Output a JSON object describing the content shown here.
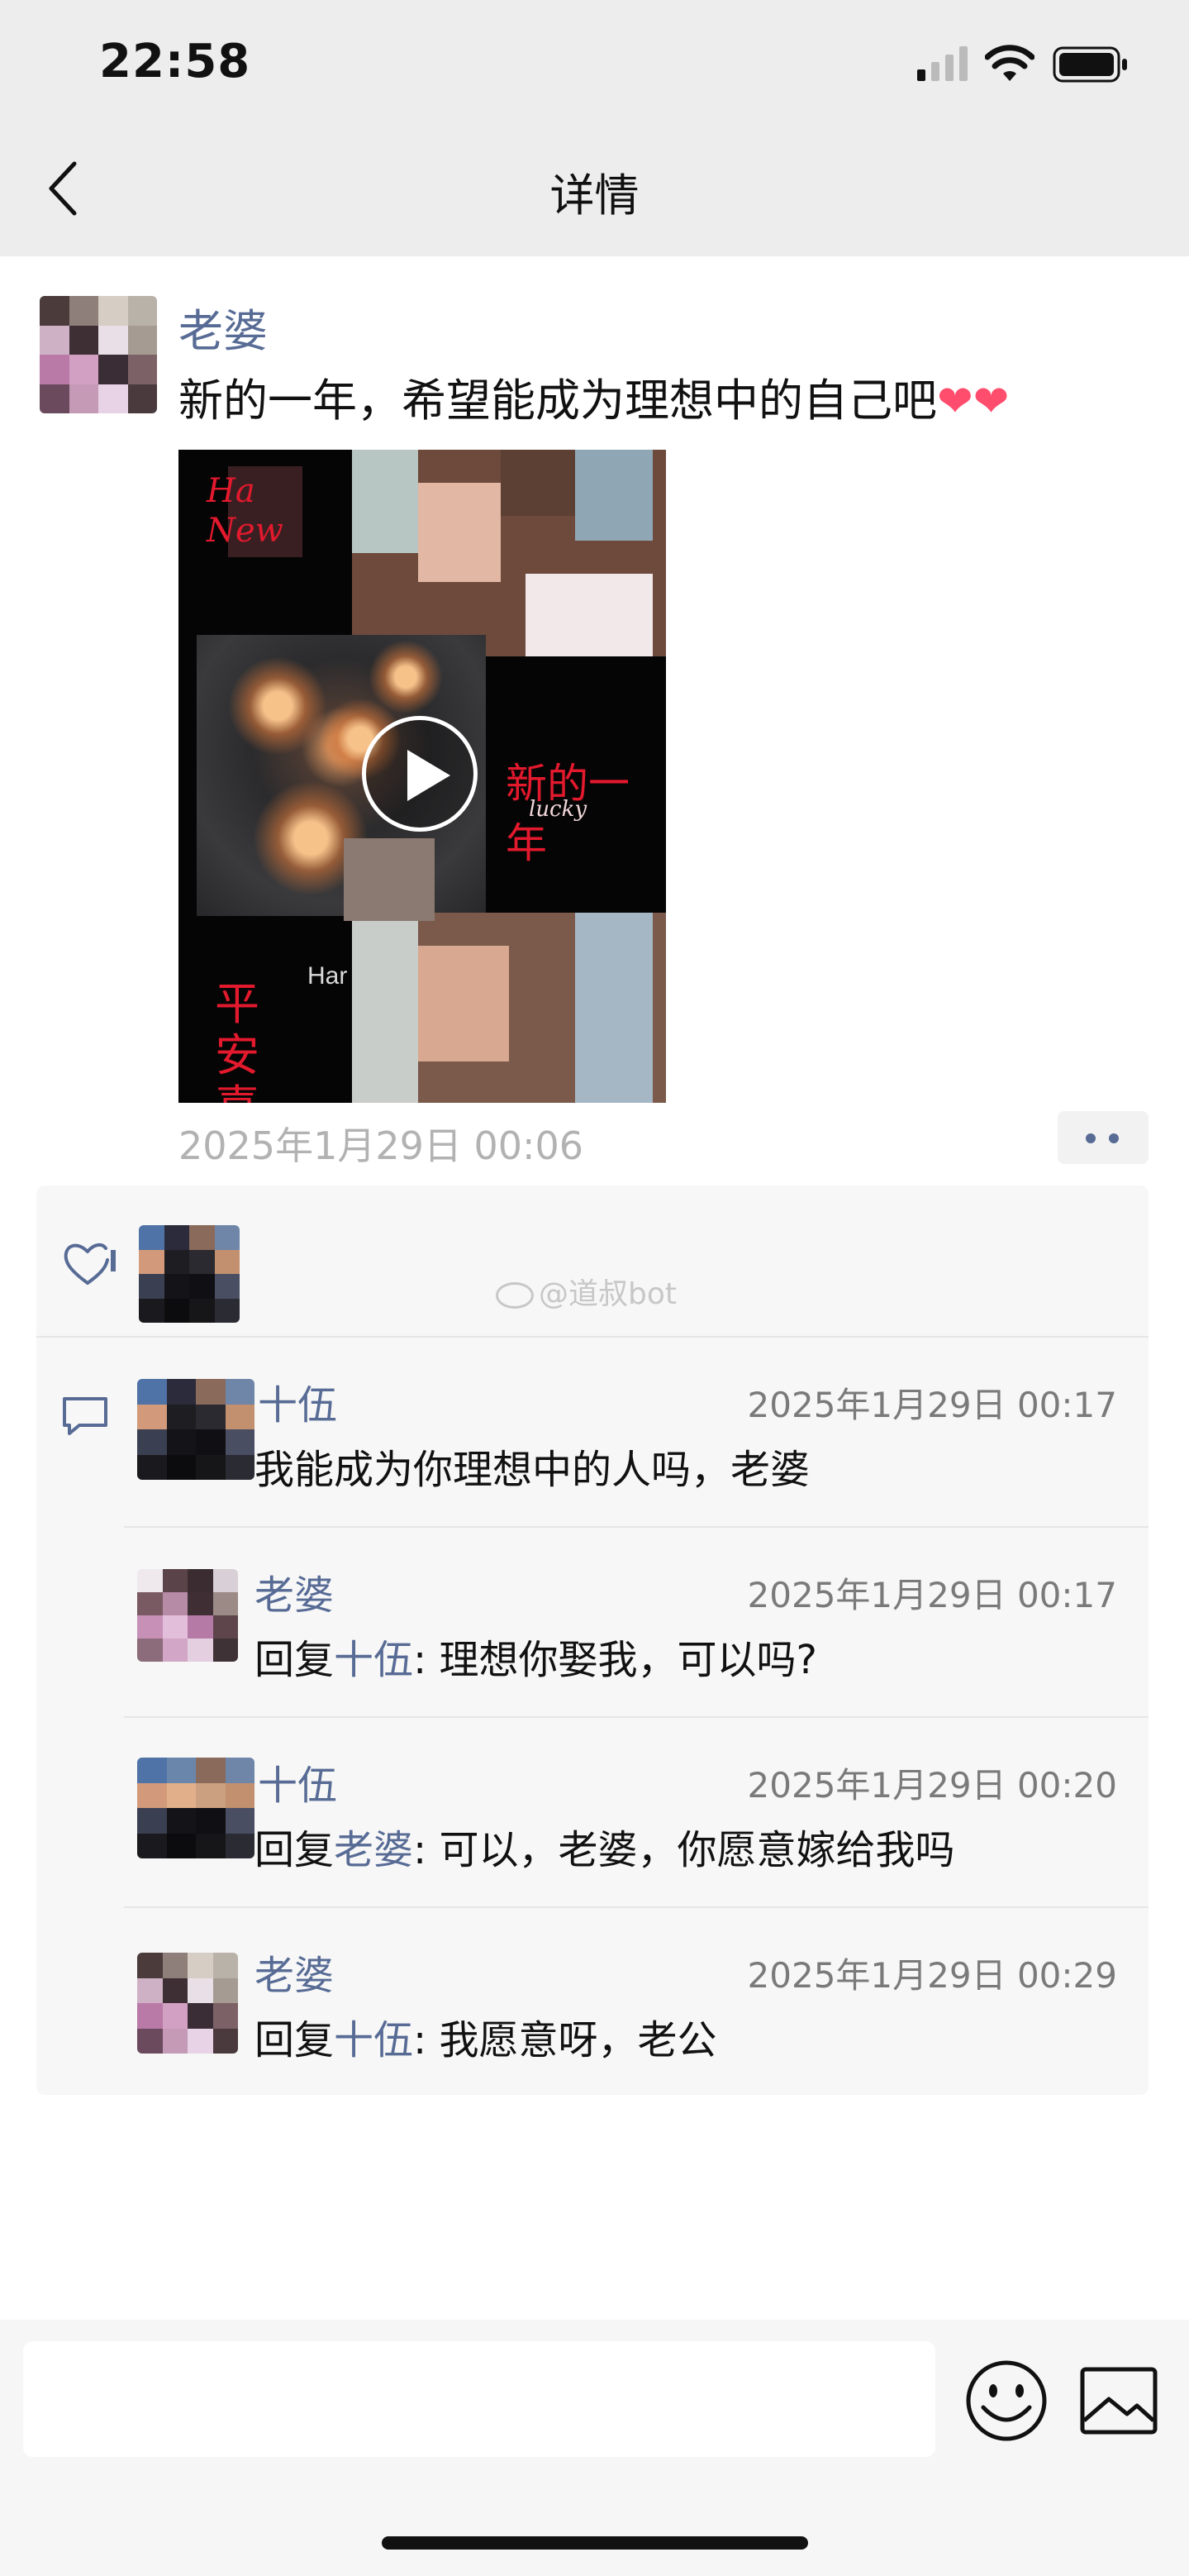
{
  "status_bar": {
    "time": "22:58"
  },
  "nav": {
    "title": "详情"
  },
  "post": {
    "author": "老婆",
    "text": "新的一年，希望能成为理想中的自己吧",
    "hearts": "❤❤",
    "timestamp": "2025年1月29日 00:06",
    "video_overlay": {
      "top_left": "Ha New",
      "right": "新的一年",
      "right_sub": "lucky",
      "bottom_left": "平安喜",
      "bottom_mid": "Har"
    }
  },
  "watermark": "@道叔bot",
  "comments": [
    {
      "name": "十伍",
      "time": "2025年1月29日 00:17",
      "prefix": "",
      "reply_to": "",
      "text": "我能成为你理想中的人吗，老婆"
    },
    {
      "name": "老婆",
      "time": "2025年1月29日 00:17",
      "prefix": "回复",
      "reply_to": "十伍",
      "text": ": 理想你娶我，可以吗?"
    },
    {
      "name": "十伍",
      "time": "2025年1月29日 00:20",
      "prefix": "回复",
      "reply_to": "老婆",
      "text": ": 可以，老婆，你愿意嫁给我吗"
    },
    {
      "name": "老婆",
      "time": "2025年1月29日 00:29",
      "prefix": "回复",
      "reply_to": "十伍",
      "text": ": 我愿意呀，老公"
    }
  ],
  "icons": {
    "back": "chevron-left-icon",
    "like": "heart-icon",
    "comment": "comment-icon",
    "emoji": "emoji-icon",
    "image": "image-icon"
  },
  "colors": {
    "link": "#576b95",
    "heart": "#ff4d6d",
    "background": "#ededed"
  }
}
